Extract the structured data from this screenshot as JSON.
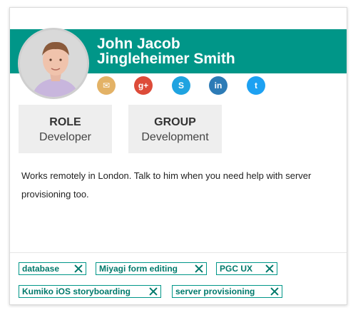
{
  "profile": {
    "name_line1": "John Jacob",
    "name_line2": "Jingleheimer Smith",
    "role_label": "ROLE",
    "role_value": "Developer",
    "group_label": "GROUP",
    "group_value": "Development",
    "description": "Works remotely in London. Talk to him when you need help with server provisioning too."
  },
  "social": [
    {
      "icon": "email-icon",
      "glyph": "✉",
      "color": "#e3b266"
    },
    {
      "icon": "google-plus-icon",
      "glyph": "g+",
      "color": "#dd4b39"
    },
    {
      "icon": "skype-icon",
      "glyph": "S",
      "color": "#1fa3e0"
    },
    {
      "icon": "linkedin-icon",
      "glyph": "in",
      "color": "#2d7bb6"
    },
    {
      "icon": "twitter-icon",
      "glyph": "t",
      "color": "#1da1f2"
    }
  ],
  "tags": [
    {
      "label": "database"
    },
    {
      "label": "Miyagi form editing"
    },
    {
      "label": "PGC UX"
    },
    {
      "label": "Kumiko iOS storyboarding"
    },
    {
      "label": "server provisioning"
    }
  ],
  "colors": {
    "accent": "#009688",
    "tag_text": "#00796b"
  }
}
